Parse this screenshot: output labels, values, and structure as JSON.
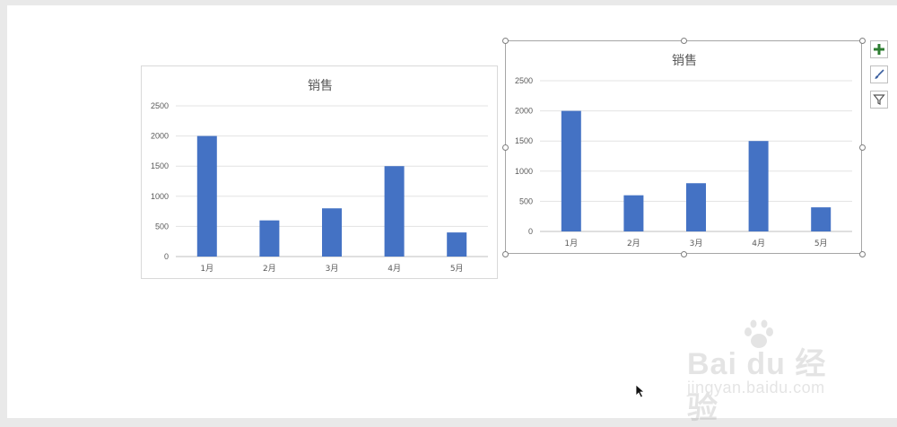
{
  "chart_data": [
    {
      "type": "bar",
      "title": "销售",
      "categories": [
        "1月",
        "2月",
        "3月",
        "4月",
        "5月"
      ],
      "values": [
        2000,
        600,
        800,
        1500,
        400
      ],
      "yticks": [
        "0",
        "500",
        "1000",
        "1500",
        "2000",
        "2500"
      ],
      "ylim": [
        0,
        2500
      ],
      "grid": true,
      "legend": "none",
      "bar_color": "#4472c4",
      "selected": false
    },
    {
      "type": "bar",
      "title": "销售",
      "categories": [
        "1月",
        "2月",
        "3月",
        "4月",
        "5月"
      ],
      "values": [
        2000,
        600,
        800,
        1500,
        400
      ],
      "yticks": [
        "0",
        "500",
        "1000",
        "1500",
        "2000",
        "2500"
      ],
      "ylim": [
        0,
        2500
      ],
      "grid": true,
      "legend": "none",
      "bar_color": "#4472c4",
      "selected": true
    }
  ],
  "side_buttons": [
    {
      "icon": "plus-icon",
      "color": "#2e7d32"
    },
    {
      "icon": "brush-icon",
      "color": "#3a5f9e"
    },
    {
      "icon": "filter-icon",
      "color": "#555555"
    }
  ],
  "watermark": {
    "logo": "Bai du 经验",
    "sub": "jingyan.baidu.com"
  }
}
